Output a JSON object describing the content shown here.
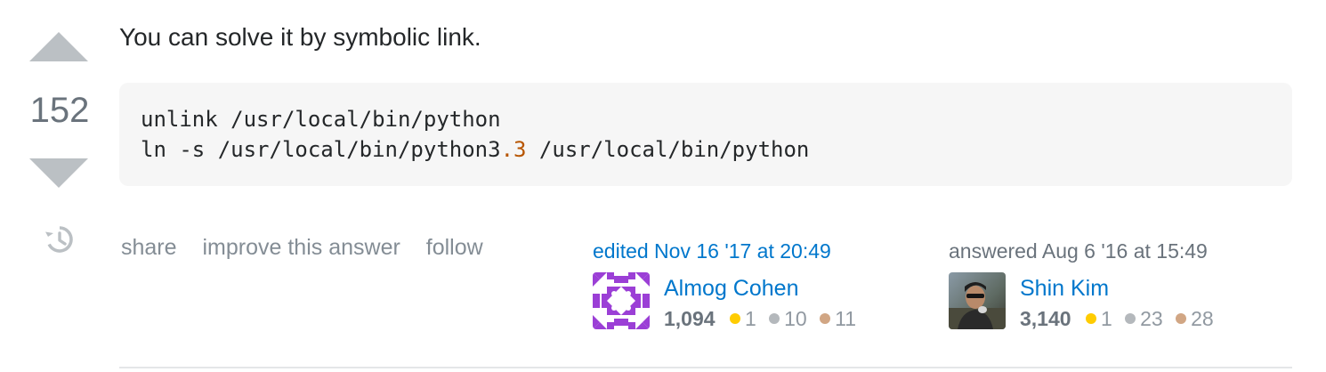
{
  "vote": {
    "count": "152"
  },
  "post": {
    "text": "You can solve it by symbolic link.",
    "code_lines": [
      {
        "before": "unlink /usr/local/bin/python",
        "literal": "",
        "after": ""
      },
      {
        "before": "ln -s /usr/local/bin/python3",
        "literal": ".3",
        "after": " /usr/local/bin/python"
      }
    ]
  },
  "menu": {
    "share": "share",
    "improve": "improve this answer",
    "follow": "follow"
  },
  "editor": {
    "action": "edited Nov 16 '17 at 20:49",
    "name": "Almog Cohen",
    "reputation": "1,094",
    "gold": "1",
    "silver": "10",
    "bronze": "11"
  },
  "owner": {
    "action": "answered Aug 6 '16 at 15:49",
    "name": "Shin Kim",
    "reputation": "3,140",
    "gold": "1",
    "silver": "23",
    "bronze": "28"
  },
  "colors": {
    "link": "#0077cc",
    "muted": "#848d95",
    "vote_arrow": "#bbc0c4",
    "code_bg": "#f6f6f6",
    "code_literal": "#b75501",
    "badge_gold": "#ffcc01",
    "badge_silver": "#b4b8bc",
    "badge_bronze": "#d1a684"
  },
  "icons": {
    "vote_up": "triangle-up-icon",
    "vote_down": "triangle-down-icon",
    "history": "history-clock-icon",
    "editor_avatar": "identicon-avatar",
    "owner_avatar": "photo-avatar"
  }
}
